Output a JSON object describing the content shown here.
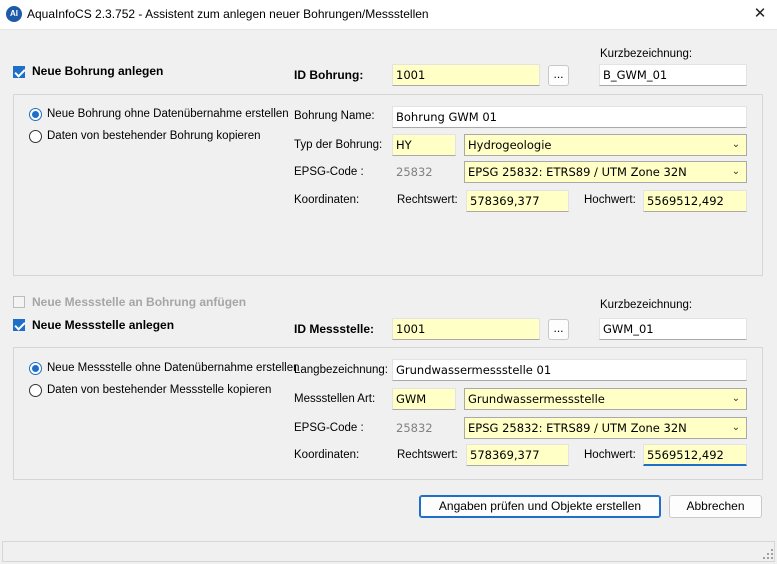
{
  "window": {
    "title": "AquaInfoCS 2.3.752 - Assistent zum anlegen neuer Bohrungen/Messstellen",
    "icon_text": "AI",
    "close_glyph": "✕"
  },
  "bohrung": {
    "checkbox_label": "Neue Bohrung anlegen",
    "id_label": "ID Bohrung:",
    "id_value": "1001",
    "browse_label": "...",
    "kurz_label": "Kurzbezeichnung:",
    "kurz_value": "B_GWM_01",
    "radio_new": "Neue Bohrung ohne Datenübernahme erstellen",
    "radio_copy": "Daten von bestehender Bohrung kopieren",
    "name_label": "Bohrung Name:",
    "name_value": "Bohrung GWM 01",
    "typ_label": "Typ der Bohrung:",
    "typ_code": "HY",
    "typ_value": "Hydrogeologie",
    "epsg_label": "EPSG-Code :",
    "epsg_code": "25832",
    "epsg_value": "EPSG 25832: ETRS89 / UTM Zone 32N",
    "koord_label": "Koordinaten:",
    "rechts_label": "Rechtswert:",
    "rechts_value": "578369,377",
    "hoch_label": "Hochwert:",
    "hoch_value": "5569512,492"
  },
  "messstelle": {
    "attach_label": "Neue Messstelle an Bohrung anfügen",
    "checkbox_label": "Neue Messstelle anlegen",
    "id_label": "ID Messstelle:",
    "id_value": "1001",
    "browse_label": "...",
    "kurz_label": "Kurzbezeichnung:",
    "kurz_value": "GWM_01",
    "radio_new": "Neue Messstelle ohne Datenübernahme erstellen",
    "radio_copy": "Daten von bestehender Messstelle kopieren",
    "lang_label": "Langbezeichnung:",
    "lang_value": "Grundwassermessstelle 01",
    "art_label": "Messstellen Art:",
    "art_code": "GWM",
    "art_value": "Grundwassermessstelle",
    "epsg_label": "EPSG-Code :",
    "epsg_code": "25832",
    "epsg_value": "EPSG 25832: ETRS89 / UTM Zone 32N",
    "koord_label": "Koordinaten:",
    "rechts_label": "Rechtswert:",
    "rechts_value": "578369,377",
    "hoch_label": "Hochwert:",
    "hoch_value": "5569512,492"
  },
  "buttons": {
    "submit": "Angaben prüfen und Objekte erstellen",
    "cancel": "Abbrechen"
  },
  "icons": {
    "dropdown": "chevron-down-icon",
    "app": "app-logo-icon",
    "close": "close-icon"
  },
  "colors": {
    "accent": "#1d6fc8",
    "required_field": "#ffffc6"
  }
}
